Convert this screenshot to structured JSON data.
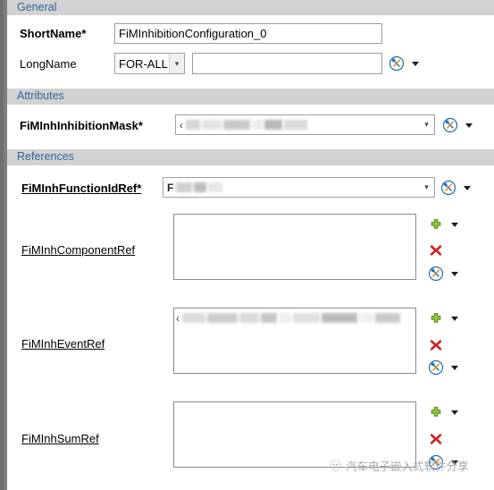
{
  "window": {
    "left_strip": true,
    "background": "#ffffff"
  },
  "sections": {
    "general": {
      "title": "General",
      "fields": {
        "shortname": {
          "label": "ShortName*",
          "value": "FiMInhibitionConfiguration_0",
          "placeholder": ""
        },
        "longname": {
          "label": "LongName",
          "lang_value": "FOR-ALL",
          "text_value": "",
          "placeholder": ""
        }
      }
    },
    "attributes": {
      "title": "Attributes",
      "fields": {
        "inhibition_mask": {
          "label": "FiMInhInhibitionMask*",
          "value": "",
          "redacted": true
        }
      }
    },
    "references": {
      "title": "References",
      "fields": {
        "function_id_ref": {
          "label": "FiMInhFunctionIdRef*",
          "value": "F",
          "redacted": true
        },
        "component_ref": {
          "label": "FiMInhComponentRef",
          "items": []
        },
        "event_ref": {
          "label": "FiMInhEventRef",
          "items": [
            {
              "value": "",
              "redacted": true
            }
          ]
        },
        "sum_ref": {
          "label": "FiMInhSumRef",
          "items": []
        }
      }
    }
  },
  "icons": {
    "tools": "tools-icon",
    "dropdown": "chevron-down-icon",
    "add": "plus-icon",
    "remove": "cross-icon",
    "combo_arrow": "chevron-down-icon"
  },
  "colors": {
    "section_header_text": "#33669c",
    "section_header_bg": "#d2d2d2",
    "tools_icon": "#1f6fb5",
    "add_icon": "#6aa516",
    "remove_icon": "#cc2222",
    "panel_bg": "#ffffff",
    "left_strip": "#7e7e7e"
  },
  "watermark": {
    "text": "汽车电子嵌入式软件分享"
  }
}
